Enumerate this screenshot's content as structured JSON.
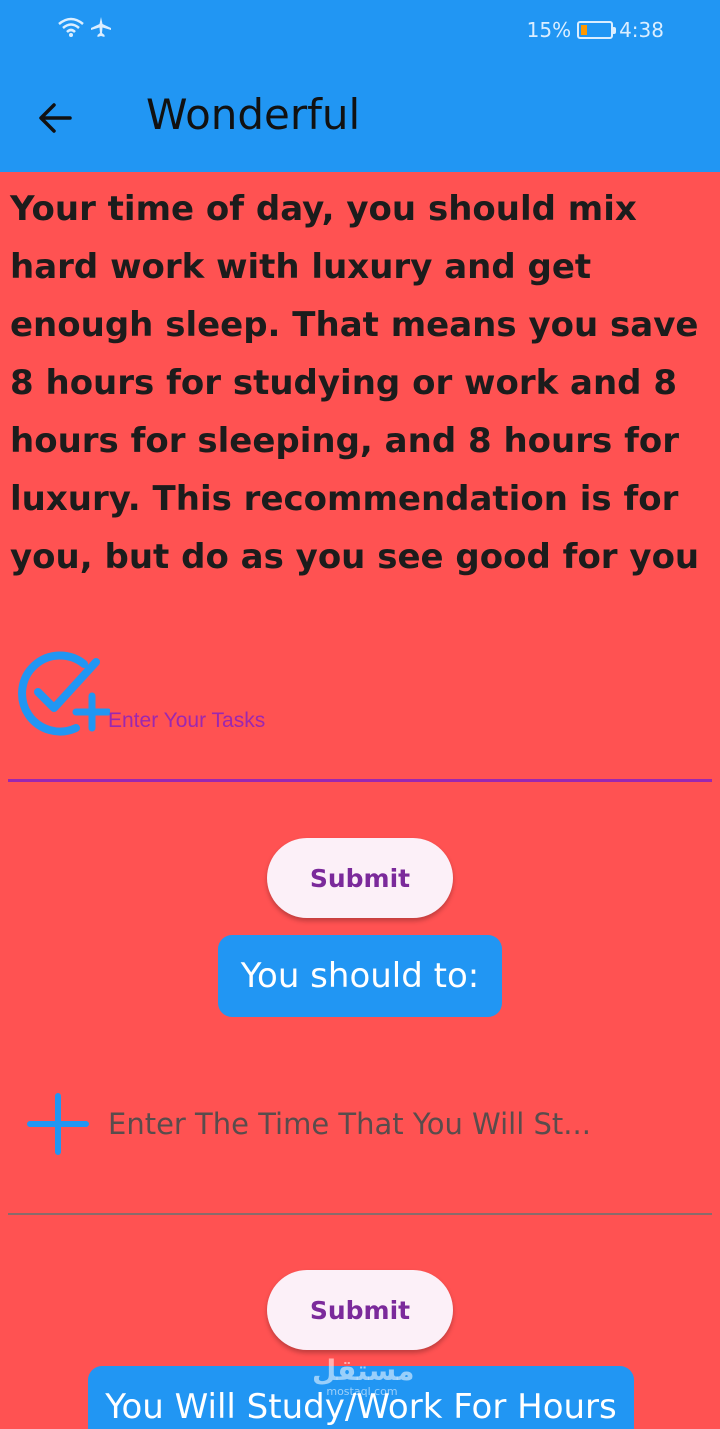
{
  "status_bar": {
    "battery_percent": "15%",
    "time": "4:38",
    "icons": [
      "wifi-icon",
      "airplane-icon",
      "battery-icon"
    ]
  },
  "app_bar": {
    "title": "Wonderful",
    "back_icon": "arrow-left-icon"
  },
  "recommendation": "Your time of day, you should mix hard work with luxury and get enough sleep. That means you save 8 hours for studying or work and 8 hours for sleeping, and 8 hours for luxury. This recommendation is for you, but do as you see good for you",
  "tasks_section": {
    "icon": "check-plus-icon",
    "placeholder": "Enter Your Tasks",
    "submit_label": "Submit",
    "result_text": "You should to:"
  },
  "time_section": {
    "icon": "plus-icon",
    "placeholder": "Enter The Time That You Will St...",
    "submit_label": "Submit",
    "result_text": "You Will Study/Work For  Hours"
  },
  "watermark": {
    "main": "مستقل",
    "sub": "mostaql.com"
  },
  "colors": {
    "primary": "#2196F3",
    "background": "#FF5252",
    "accent": "#9C27B0"
  }
}
